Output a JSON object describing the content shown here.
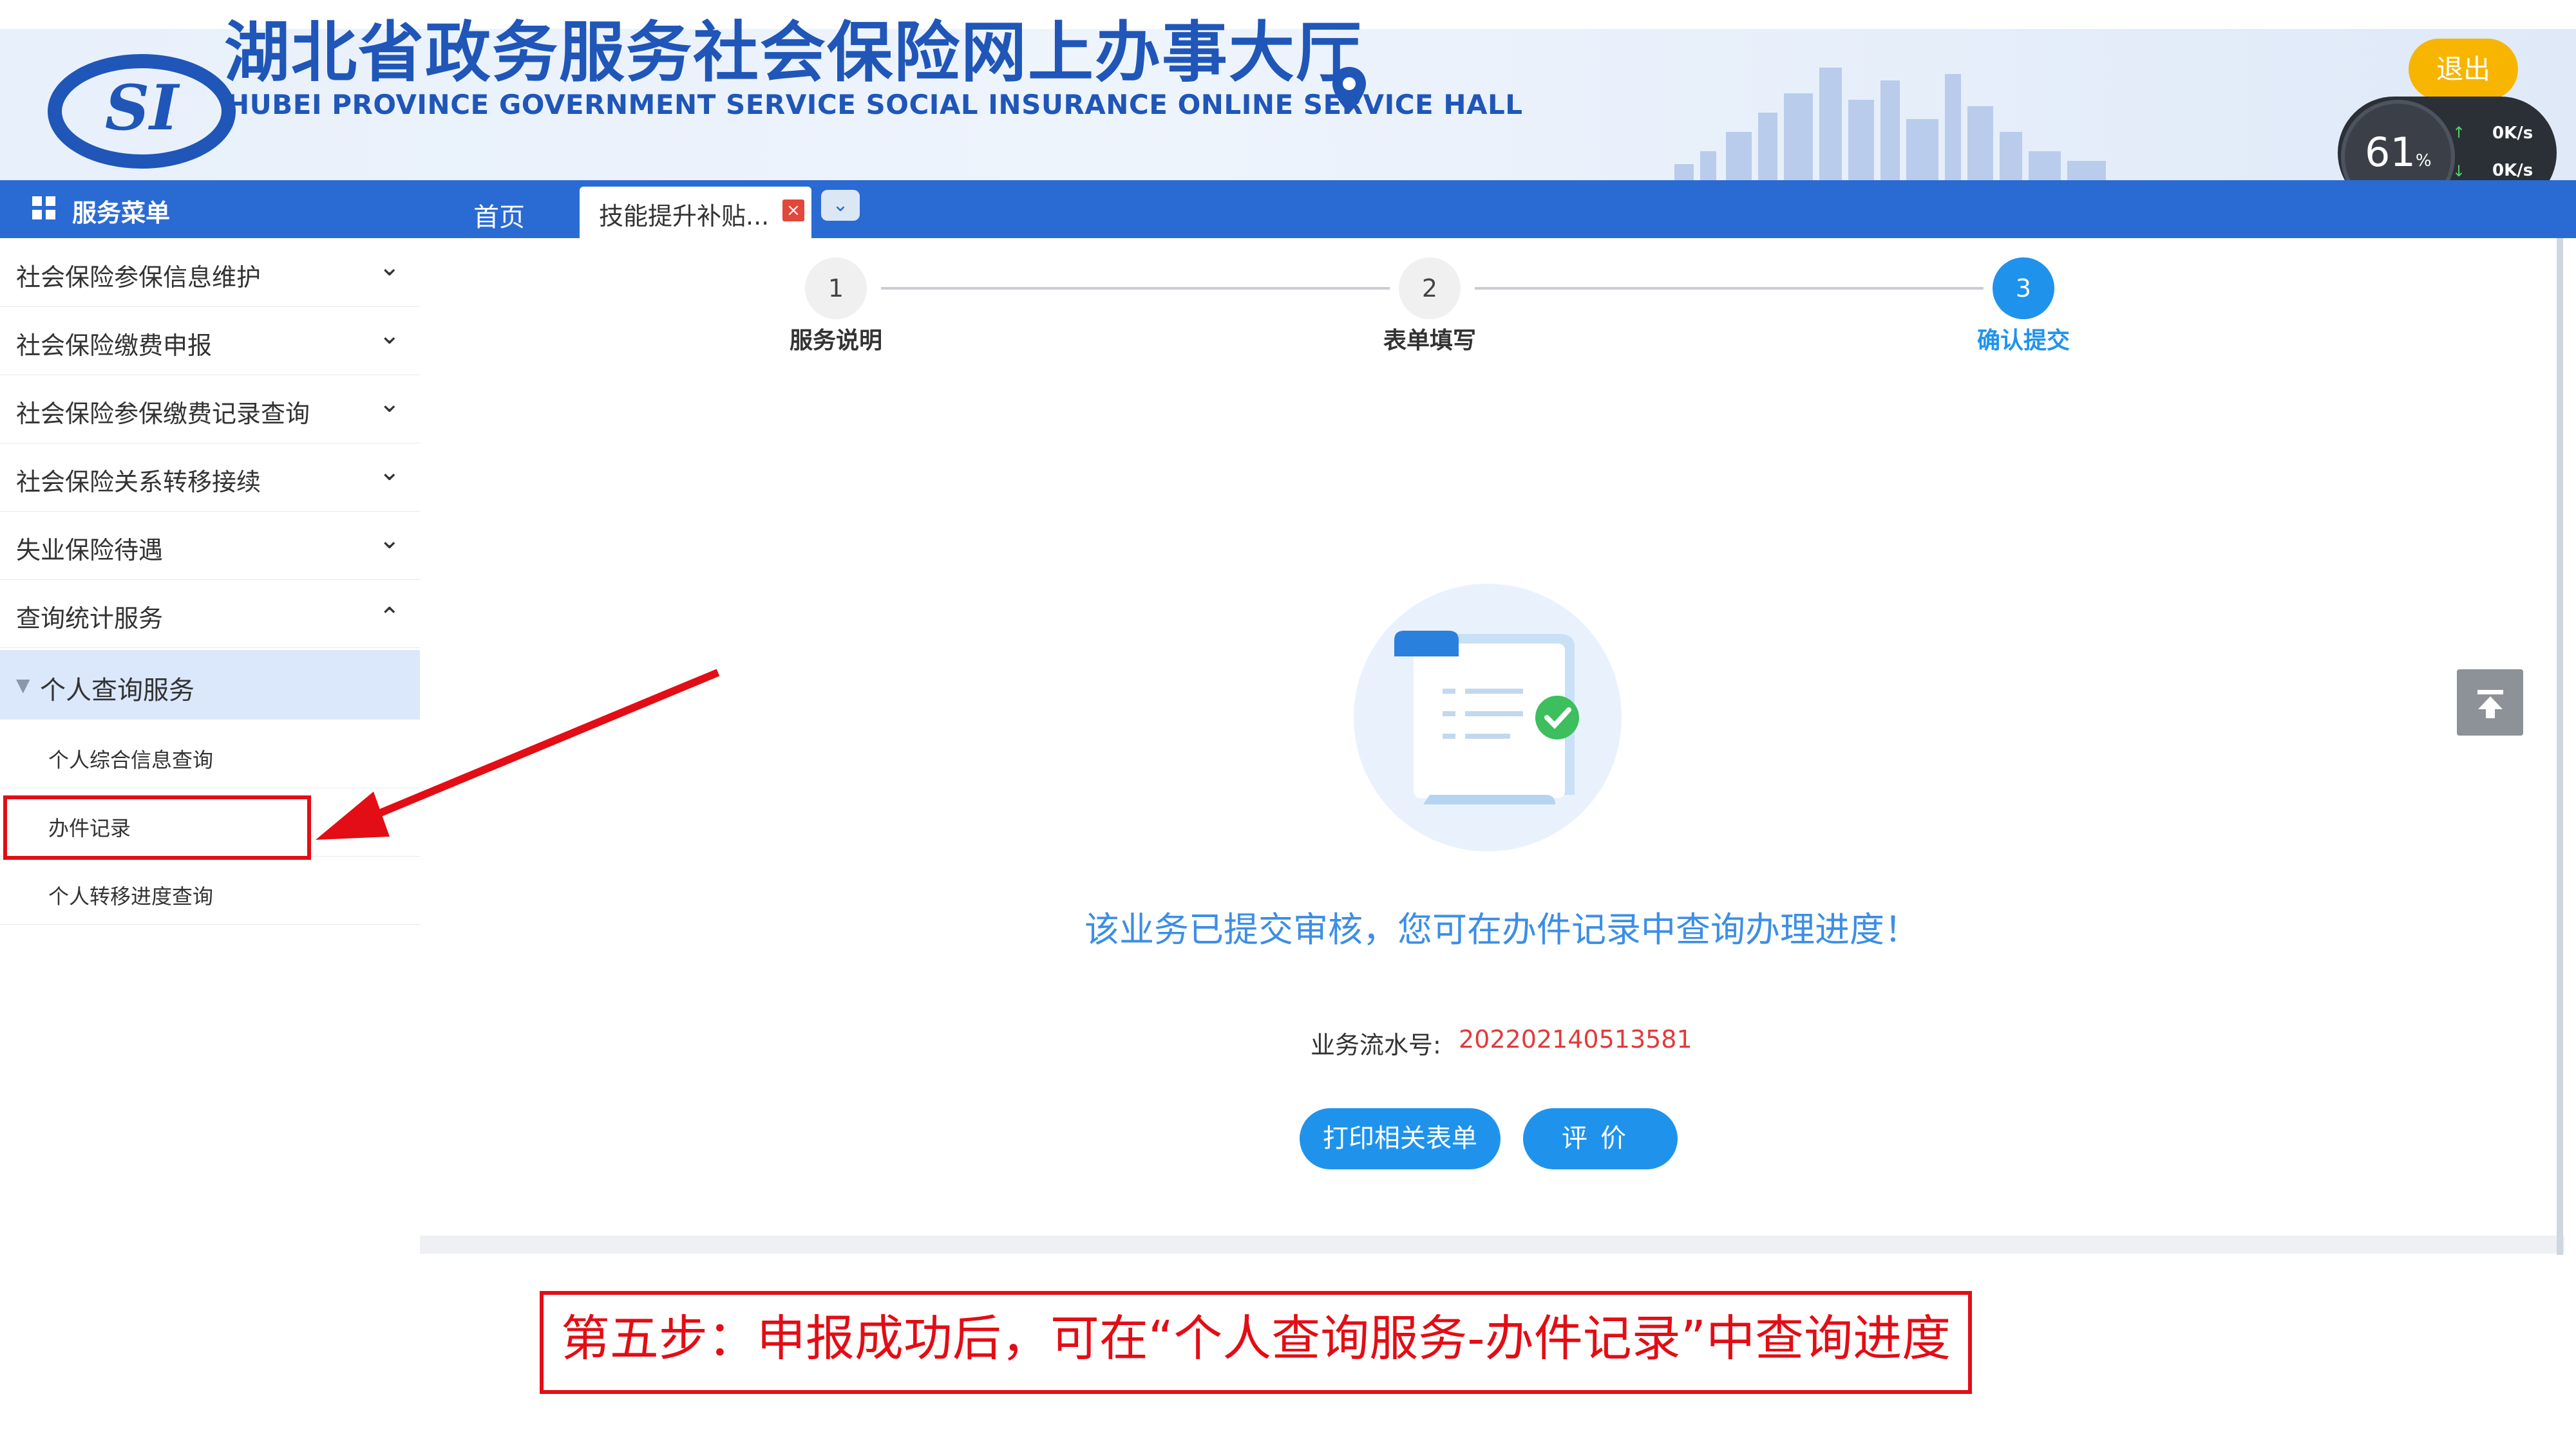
{
  "header": {
    "title": "湖北省政务服务社会保险网上办事大厅",
    "subtitle": "HUBEI PROVINCE GOVERNMENT SERVICE SOCIAL INSURANCE ONLINE SERVICE HALL",
    "logo_text": "SI",
    "logout_label": "退出",
    "speed_value": "61",
    "speed_unit": "%",
    "upload_rate": "0K/s",
    "download_rate": "0K/s"
  },
  "nav": {
    "menu_title": "服务菜单",
    "tabs": [
      {
        "label": "首页"
      },
      {
        "label": "技能提升补贴..."
      }
    ]
  },
  "sidebar": {
    "items": [
      {
        "label": "社会保险参保信息维护",
        "expanded": false
      },
      {
        "label": "社会保险缴费申报",
        "expanded": false
      },
      {
        "label": "社会保险参保缴费记录查询",
        "expanded": false
      },
      {
        "label": "社会保险关系转移接续",
        "expanded": false
      },
      {
        "label": "失业保险待遇",
        "expanded": false
      },
      {
        "label": "查询统计服务",
        "expanded": true
      }
    ],
    "sub_group": "个人查询服务",
    "sub_items": [
      {
        "label": "个人综合信息查询"
      },
      {
        "label": "办件记录"
      },
      {
        "label": "个人转移进度查询"
      }
    ]
  },
  "stepper": {
    "steps": [
      {
        "number": "1",
        "label": "服务说明",
        "active": false
      },
      {
        "number": "2",
        "label": "表单填写",
        "active": false
      },
      {
        "number": "3",
        "label": "确认提交",
        "active": true
      }
    ],
    "active_color": "#1f93ec"
  },
  "result": {
    "message": "该业务已提交审核，您可在办件记录中查询办理进度！",
    "serial_label": "业务流水号:",
    "serial_value": "202202140513581",
    "print_button": "打印相关表单",
    "evaluate_button": "评价"
  },
  "annotation": {
    "caption": "第五步：申报成功后，可在“个人查询服务-办件记录”中查询进度",
    "highlight_color": "#e30d15"
  },
  "colors": {
    "brand_blue": "#2a6ad3",
    "button_blue": "#1f93ec",
    "logout_yellow": "#f7b500",
    "serial_red": "#e23a3a"
  }
}
